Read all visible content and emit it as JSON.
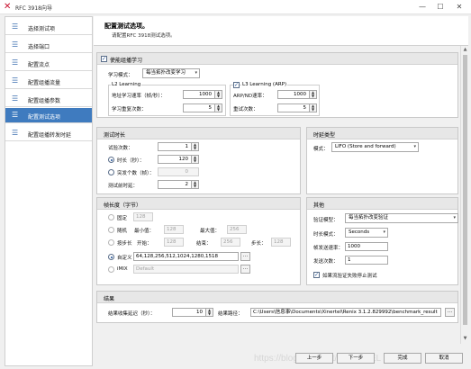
{
  "window": {
    "title": "RFC 3918向导",
    "minimize": "—",
    "maximize": "☐",
    "close": "✕"
  },
  "sidebar": {
    "items": [
      {
        "label": "选择测试项"
      },
      {
        "label": "选择端口"
      },
      {
        "label": "配置流点"
      },
      {
        "label": "配置组播流量"
      },
      {
        "label": "配置组播参数"
      },
      {
        "label": "配置测试选项",
        "active": true
      },
      {
        "label": "配置组播转发时延"
      }
    ]
  },
  "header": {
    "title": "配置测试选项。",
    "subtitle": "请配置RFC 3918测试选项。"
  },
  "multicast": {
    "enable_label": "使能组播学习",
    "learn_mode_label": "学习模式：",
    "learn_mode_value": "每当拓扑改变学习",
    "l2": {
      "title": "L2 Learning",
      "rate_label": "地址学习速率（帧/秒）：",
      "rate_value": "1000",
      "retry_label": "学习重复次数：",
      "retry_value": "5"
    },
    "l3": {
      "enable_label": "L3 Learning (ARP)",
      "rate_label": "ARP/ND速率：",
      "rate_value": "1000",
      "retry_label": "重试次数：",
      "retry_value": "5"
    }
  },
  "duration": {
    "title": "测试时长",
    "trials_label": "试验次数：",
    "trials_value": "1",
    "time_label": "时长（秒）：",
    "time_value": "120",
    "burst_label": "突发个数（帧）：",
    "burst_value": "0",
    "gap_label": "测试前时延：",
    "gap_value": "2"
  },
  "timing": {
    "title": "时延类型",
    "mode_label": "模式：",
    "mode_value": "LIFO (Store and forward)"
  },
  "framesize": {
    "title": "帧长度（字节）",
    "fixed_label": "固定",
    "fixed_value": "128",
    "random_label": "随机",
    "min_label": "最小值：",
    "min_value": "128",
    "max_label": "最大值：",
    "max_value": "256",
    "step_label": "按步长",
    "start_label": "开始：",
    "start_value": "128",
    "end_label": "结束：",
    "end_value": "256",
    "stepsize_label": "步长：",
    "stepsize_value": "128",
    "custom_label": "自定义",
    "custom_value": "64,128,256,512,1024,1280,1518",
    "imix_label": "iMIX",
    "imix_value": "Default",
    "browse": "..."
  },
  "other": {
    "title": "其他",
    "verify_label": "验证模型：",
    "verify_value": "每当拓扑改变验证",
    "duration_mode_label": "时长模式：",
    "duration_mode_value": "Seconds",
    "burst_rate_label": "帧发送速率：",
    "burst_rate_value": "1000",
    "send_count_label": "发送次数：",
    "send_count_value": "1",
    "stop_label": "如果流验证失败停止测试"
  },
  "result": {
    "title": "结果",
    "delay_label": "结果收集延迟（秒）：",
    "delay_value": "10",
    "path_label": "结果路径：",
    "path_value": "C:\\Users\\信息事\\Documents\\Xinertel\\Renix 3.1.2.829992\\benchmark_result",
    "browse": "..."
  },
  "footer": {
    "back": "上一步",
    "next": "下一步",
    "finish": "完成",
    "cancel": "取消"
  },
  "watermark": "https://blog.csdn.net/XINERTEL"
}
